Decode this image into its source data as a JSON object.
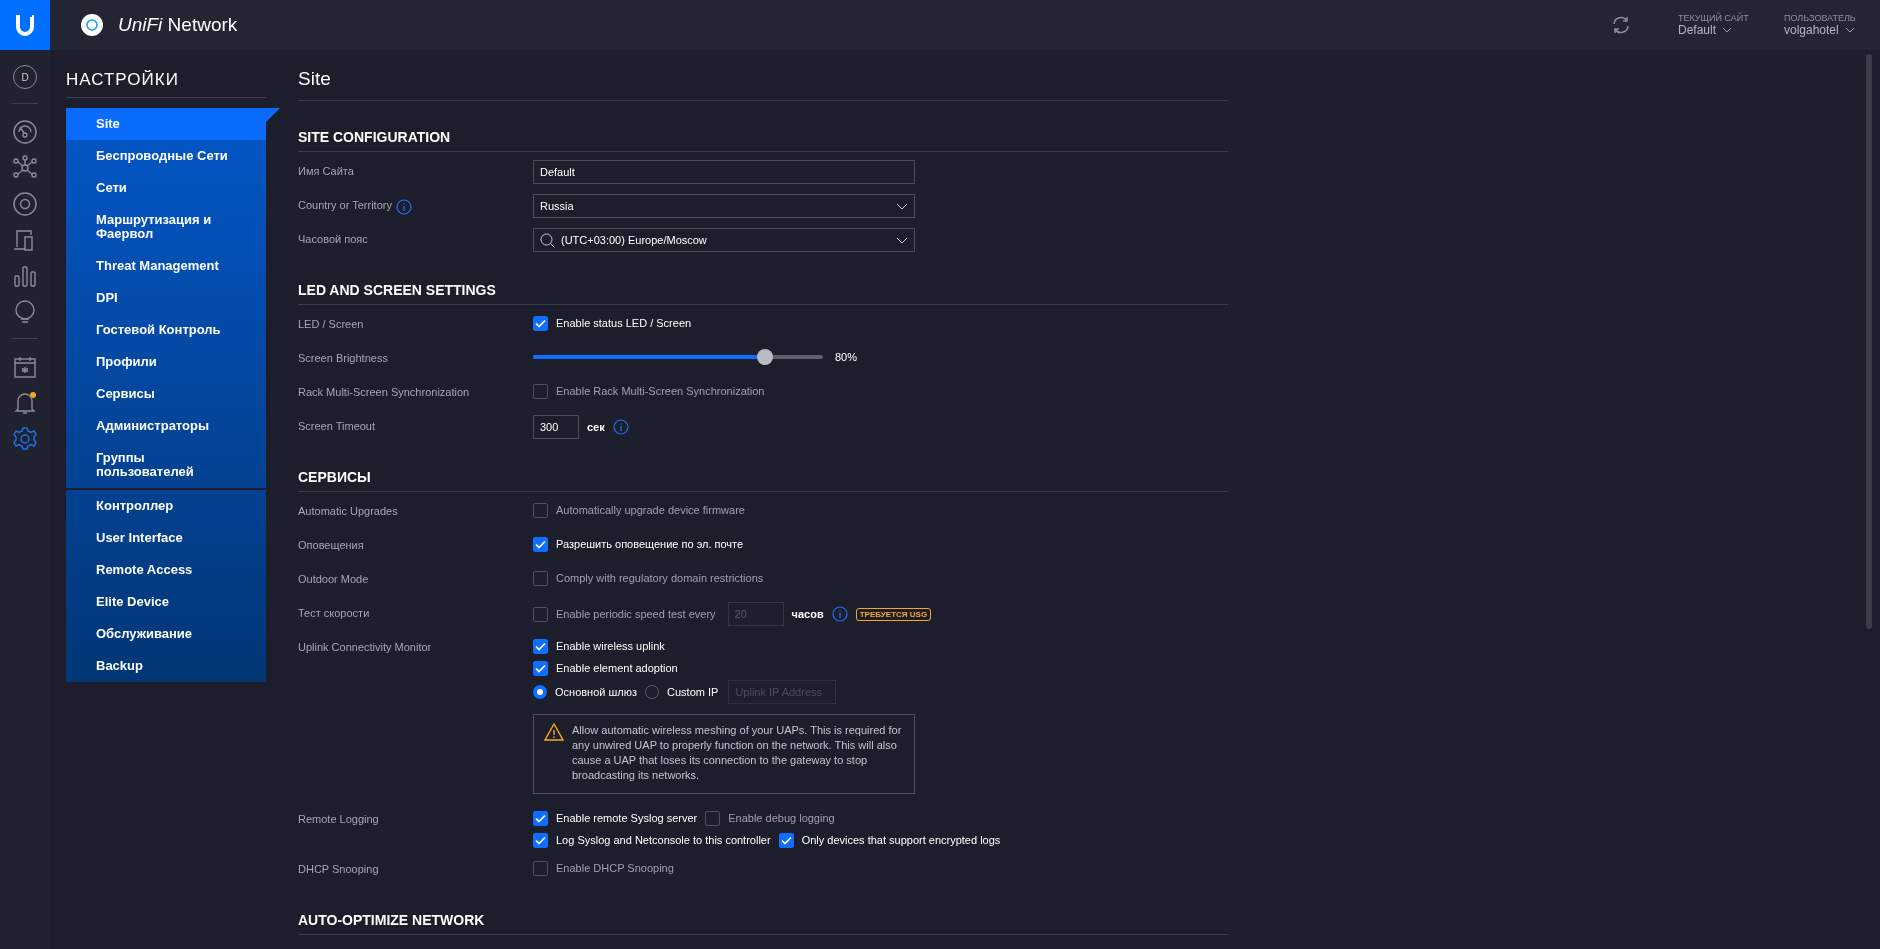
{
  "topbar": {
    "brand": "*UniFi* Network",
    "site_label": "ТЕКУЩИЙ САЙТ",
    "site": "Default",
    "user_label": "ПОЛЬЗОВАТЕЛЬ",
    "user": "volgahotel"
  },
  "rail": {
    "avatar": "D",
    "groups": [
      [
        {
          "selected": false,
          "alert": false
        },
        {
          "selected": false,
          "alert": false
        },
        {
          "selected": false,
          "alert": false
        },
        {
          "selected": false,
          "alert": false
        },
        {
          "selected": false,
          "alert": false
        },
        {
          "selected": false,
          "alert": false
        }
      ],
      [
        {
          "selected": false,
          "alert": false
        },
        {
          "selected": false,
          "alert": true
        },
        {
          "selected": true,
          "alert": false
        }
      ]
    ]
  },
  "settings_nav": {
    "title": "НАСТРОЙКИ",
    "groups": [
      [
        {
          "label": "Site",
          "selected": true
        },
        {
          "label": "Беспроводные Сети",
          "selected": false
        },
        {
          "label": "Сети",
          "selected": false
        },
        {
          "label": "Маршрутизация и Фаервол",
          "selected": false
        },
        {
          "label": "Threat Management",
          "selected": false
        },
        {
          "label": "DPI",
          "selected": false
        },
        {
          "label": "Гостевой Контроль",
          "selected": false
        },
        {
          "label": "Профили",
          "selected": false
        },
        {
          "label": "Сервисы",
          "selected": false
        },
        {
          "label": "Администраторы",
          "selected": false
        },
        {
          "label": "Группы пользователей",
          "selected": false
        }
      ],
      [
        {
          "label": "Контроллер",
          "selected": false
        },
        {
          "label": "User Interface",
          "selected": false
        },
        {
          "label": "Remote Access",
          "selected": false
        },
        {
          "label": "Elite Device",
          "selected": false
        },
        {
          "label": "Обслуживание",
          "selected": false
        },
        {
          "label": "Backup",
          "selected": false
        }
      ]
    ]
  },
  "page": {
    "title": "Site",
    "sections": [
      {
        "title": "SITE CONFIGURATION",
        "rows": [
          {
            "label": "Имя Сайта",
            "info": false,
            "lines": [
              [
                {
                  "kind": "text",
                  "value": "Default"
                }
              ]
            ]
          },
          {
            "label": "Country or Territory",
            "info": true,
            "lines": [
              [
                {
                  "kind": "select",
                  "value": "Russia",
                  "search": false
                }
              ]
            ]
          },
          {
            "label": "Часовой пояс",
            "info": false,
            "lines": [
              [
                {
                  "kind": "select",
                  "value": "(UTC+03:00) Europe/Moscow",
                  "search": true
                }
              ]
            ]
          }
        ]
      },
      {
        "title": "LED AND SCREEN SETTINGS",
        "rows": [
          {
            "label": "LED / Screen",
            "info": false,
            "lines": [
              [
                {
                  "kind": "checkbox",
                  "label": "Enable status LED / Screen",
                  "checked": true
                }
              ]
            ]
          },
          {
            "label": "Screen Brightness",
            "info": false,
            "lines": [
              [
                {
                  "kind": "slider",
                  "level": 0.8,
                  "reading": "80%"
                }
              ]
            ]
          },
          {
            "label": "Rack Multi-Screen Synchronization",
            "info": false,
            "lines": [
              [
                {
                  "kind": "checkbox",
                  "label": "Enable Rack Multi-Screen Synchronization",
                  "checked": false
                }
              ]
            ]
          },
          {
            "label": "Screen Timeout",
            "info": false,
            "lines": [
              [
                {
                  "kind": "number",
                  "value": "300",
                  "disabled": false
                },
                {
                  "kind": "unit",
                  "text": "сек"
                },
                {
                  "kind": "info"
                }
              ]
            ]
          }
        ]
      },
      {
        "title": "СЕРВИСЫ",
        "rows": [
          {
            "label": "Automatic Upgrades",
            "info": false,
            "lines": [
              [
                {
                  "kind": "checkbox",
                  "label": "Automatically upgrade device firmware",
                  "checked": false
                }
              ]
            ]
          },
          {
            "label": "Оповещения",
            "info": false,
            "lines": [
              [
                {
                  "kind": "checkbox",
                  "label": "Разрешить оповещение по эл. почте",
                  "checked": true
                }
              ]
            ]
          },
          {
            "label": "Outdoor Mode",
            "info": false,
            "lines": [
              [
                {
                  "kind": "checkbox",
                  "label": "Comply with regulatory domain restrictions",
                  "checked": false
                }
              ]
            ]
          },
          {
            "label": "Тест скорости",
            "info": false,
            "lines": [
              [
                {
                  "kind": "checkbox",
                  "label": "Enable periodic speed test every",
                  "checked": false
                },
                {
                  "kind": "number",
                  "placeholder": "20",
                  "disabled": true
                },
                {
                  "kind": "unit",
                  "text": "часов"
                },
                {
                  "kind": "info"
                },
                {
                  "kind": "badge",
                  "text": "ТРЕБУЕТСЯ USG"
                }
              ]
            ]
          },
          {
            "label": "Uplink Connectivity Monitor",
            "info": false,
            "lines": [
              [
                {
                  "kind": "checkbox",
                  "label": "Enable wireless uplink",
                  "checked": true
                }
              ],
              [
                {
                  "kind": "checkbox",
                  "label": "Enable element adoption",
                  "checked": true
                }
              ],
              [
                {
                  "kind": "radio",
                  "label": "Основной шлюз",
                  "selected": true
                },
                {
                  "kind": "radio",
                  "label": "Custom IP",
                  "selected": false
                },
                {
                  "kind": "input",
                  "placeholder": "Uplink IP Address"
                }
              ],
              [
                {
                  "kind": "note",
                  "text": "Allow automatic wireless meshing of your UAPs. This is required for any unwired UAP to properly function on the network. This will also cause a UAP that loses its connection to the gateway to stop broadcasting its networks."
                }
              ]
            ]
          },
          {
            "label": "Remote Logging",
            "info": false,
            "lines": [
              [
                {
                  "kind": "checkbox",
                  "label": "Enable remote Syslog server",
                  "checked": true
                },
                {
                  "kind": "checkbox",
                  "label": "Enable debug logging",
                  "checked": false
                }
              ],
              [
                {
                  "kind": "checkbox",
                  "label": "Log Syslog and Netconsole to this controller",
                  "checked": true
                },
                {
                  "kind": "checkbox",
                  "label": "Only devices that support encrypted logs",
                  "checked": true
                }
              ]
            ]
          },
          {
            "label": "DHCP Snooping",
            "info": false,
            "lines": [
              [
                {
                  "kind": "checkbox",
                  "label": "Enable DHCP Snooping",
                  "checked": false
                }
              ]
            ]
          }
        ]
      },
      {
        "title": "AUTO-OPTIMIZE NETWORK"
      }
    ]
  }
}
